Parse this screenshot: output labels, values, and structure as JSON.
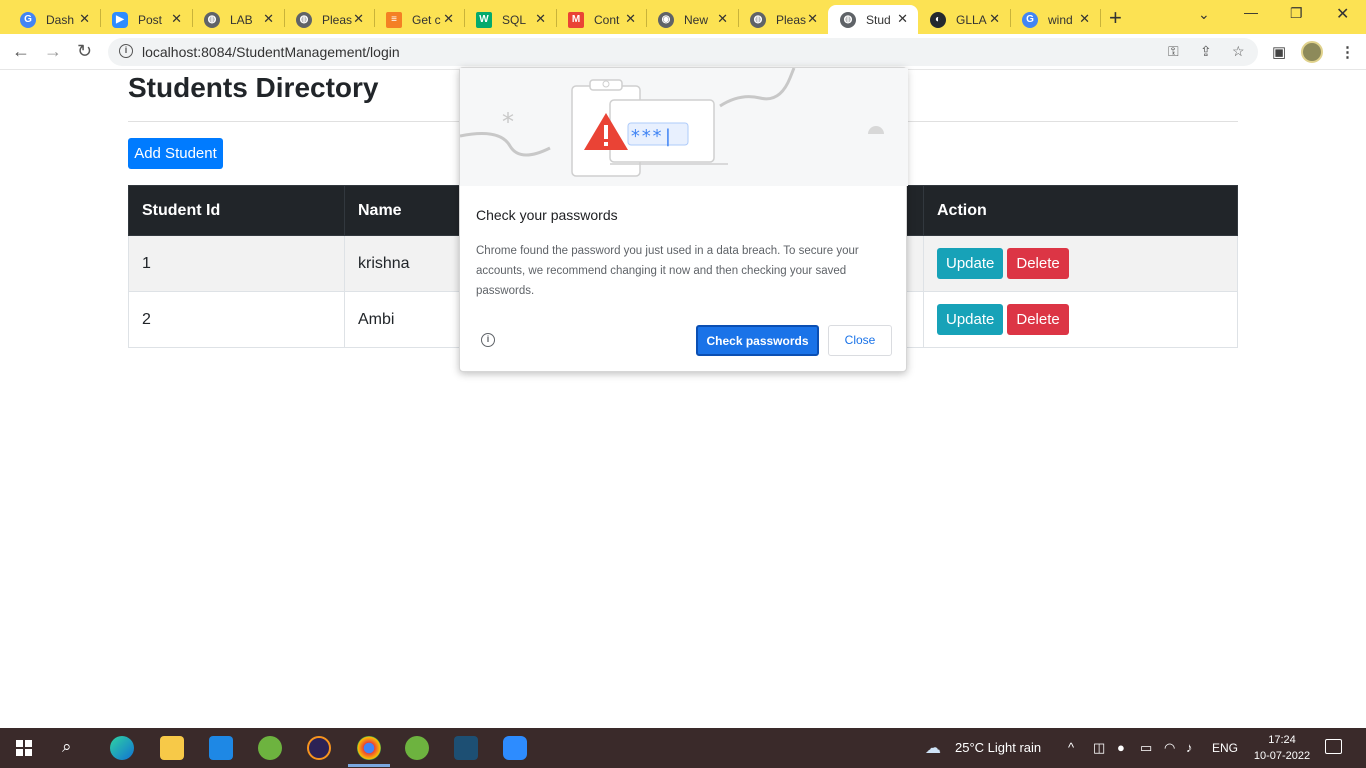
{
  "browser": {
    "tabs": [
      {
        "label": "Dash",
        "icon": "google-icon",
        "color": "#4285f4",
        "glyph": "G"
      },
      {
        "label": "Post",
        "icon": "zoom-icon",
        "color": "#2d8cff",
        "glyph": "▶"
      },
      {
        "label": "LAB",
        "icon": "globe-icon",
        "color": "#5f6368",
        "glyph": "◍"
      },
      {
        "label": "Pleas",
        "icon": "globe-icon",
        "color": "#5f6368",
        "glyph": "◍"
      },
      {
        "label": "Get c",
        "icon": "stackoverflow-icon",
        "color": "#f48024",
        "glyph": "≡"
      },
      {
        "label": "SQL",
        "icon": "w3schools-icon",
        "color": "#04aa6d",
        "glyph": "W"
      },
      {
        "label": "Cont",
        "icon": "gmail-icon",
        "color": "#ea4335",
        "glyph": "M"
      },
      {
        "label": "New",
        "icon": "chrome-icon",
        "color": "#5f6368",
        "glyph": "◉"
      },
      {
        "label": "Pleas",
        "icon": "globe-icon",
        "color": "#5f6368",
        "glyph": "◍"
      },
      {
        "label": "Stud",
        "icon": "globe-icon",
        "color": "#5f6368",
        "glyph": "◍",
        "active": true
      },
      {
        "label": "GLLA",
        "icon": "github-icon",
        "color": "#24292f",
        "glyph": "◐"
      },
      {
        "label": "wind",
        "icon": "google-icon",
        "color": "#4285f4",
        "glyph": "G"
      }
    ],
    "url": "localhost:8084/StudentManagement/login"
  },
  "page": {
    "title": "Students Directory",
    "add_button": "Add Student",
    "table": {
      "headers": [
        "Student Id",
        "Name",
        "Action"
      ],
      "rows": [
        {
          "id": "1",
          "name": "krishna"
        },
        {
          "id": "2",
          "name": "Ambi"
        }
      ],
      "update_label": "Update",
      "delete_label": "Delete"
    }
  },
  "popup": {
    "title": "Check your passwords",
    "body": "Chrome found the password you just used in a data breach. To secure your accounts, we recommend changing it now and then checking your saved passwords.",
    "password_mask": "***|",
    "check_button": "Check passwords",
    "close_button": "Close"
  },
  "taskbar": {
    "weather": "25°C  Light rain",
    "language": "ENG",
    "time": "17:24",
    "date": "10-07-2022"
  },
  "colors": {
    "tabbar": "#fce253",
    "primary": "#007bff",
    "update": "#17a2b8",
    "delete": "#dc3545",
    "table_header": "#212529",
    "chrome_blue": "#1a73e8"
  }
}
